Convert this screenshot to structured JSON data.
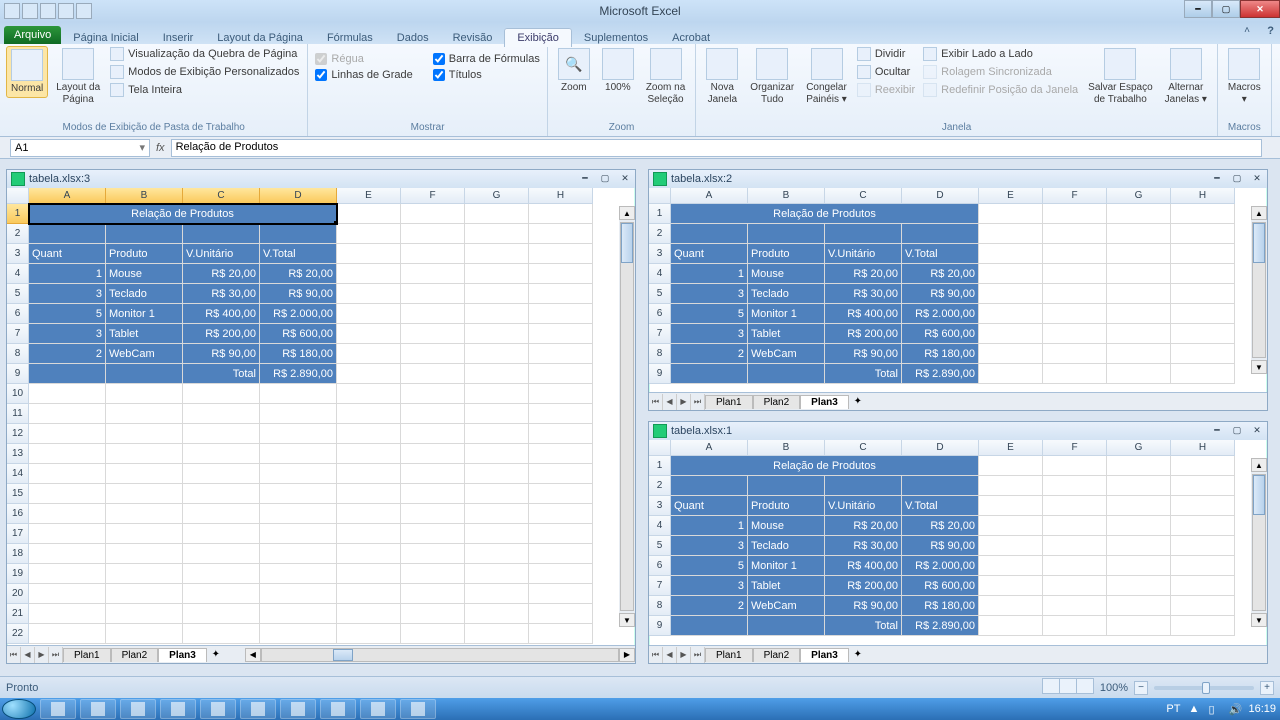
{
  "app_title": "Microsoft Excel",
  "qat_items": [
    "excel-icon",
    "save-icon",
    "undo-icon",
    "redo-icon",
    "qat-more"
  ],
  "file_tab": "Arquivo",
  "tabs": [
    "Página Inicial",
    "Inserir",
    "Layout da Página",
    "Fórmulas",
    "Dados",
    "Revisão",
    "Exibição",
    "Suplementos",
    "Acrobat"
  ],
  "active_tab_index": 6,
  "ribbon": {
    "group1": {
      "title": "Modos de Exibição de Pasta de Trabalho",
      "normal": "Normal",
      "layout": "Layout da\nPágina",
      "quebra": "Visualização da Quebra de Página",
      "modos": "Modos de Exibição Personalizados",
      "tela": "Tela Inteira"
    },
    "group2": {
      "title": "Mostrar",
      "regua": "Régua",
      "linhas": "Linhas de Grade",
      "barra": "Barra de Fórmulas",
      "titulos": "Títulos"
    },
    "group3": {
      "title": "Zoom",
      "zoom": "Zoom",
      "cem": "100%",
      "selecao": "Zoom na\nSeleção"
    },
    "group4": {
      "title": "Janela",
      "nova": "Nova\nJanela",
      "organizar": "Organizar\nTudo",
      "congelar": "Congelar\nPainéis ▾",
      "dividir": "Dividir",
      "ocultar": "Ocultar",
      "reexibir": "Reexibir",
      "lado": "Exibir Lado a Lado",
      "rolagem": "Rolagem Sincronizada",
      "redefinir": "Redefinir Posição da Janela",
      "salvar": "Salvar Espaço\nde Trabalho",
      "alternar": "Alternar\nJanelas ▾"
    },
    "group5": {
      "title": "Macros",
      "macros": "Macros\n▾"
    }
  },
  "namebox": "A1",
  "formula": "Relação de Produtos",
  "windows": [
    {
      "title": "tabela.xlsx:3"
    },
    {
      "title": "tabela.xlsx:2"
    },
    {
      "title": "tabela.xlsx:1"
    }
  ],
  "columns": [
    "A",
    "B",
    "C",
    "D",
    "E",
    "F",
    "G",
    "H"
  ],
  "table": {
    "title": "Relação de Produtos",
    "headers": {
      "quant": "Quant",
      "produto": "Produto",
      "vunit": "V.Unitário",
      "vtotal": "V.Total"
    },
    "rows": [
      {
        "q": "1",
        "p": "Mouse",
        "u": "R$    20,00",
        "t": "R$      20,00"
      },
      {
        "q": "3",
        "p": "Teclado",
        "u": "R$    30,00",
        "t": "R$      90,00"
      },
      {
        "q": "5",
        "p": "Monitor 1",
        "u": "R$  400,00",
        "t": "R$ 2.000,00"
      },
      {
        "q": "3",
        "p": "Tablet",
        "u": "R$  200,00",
        "t": "R$    600,00"
      },
      {
        "q": "2",
        "p": "WebCam",
        "u": "R$    90,00",
        "t": "R$    180,00"
      }
    ],
    "total_label": "Total",
    "total_value": "R$ 2.890,00"
  },
  "sheet_tabs": [
    "Plan1",
    "Plan2",
    "Plan3"
  ],
  "active_sheet": 2,
  "status": "Pronto",
  "zoom": "100%",
  "lang": "PT",
  "clock": "16:19"
}
